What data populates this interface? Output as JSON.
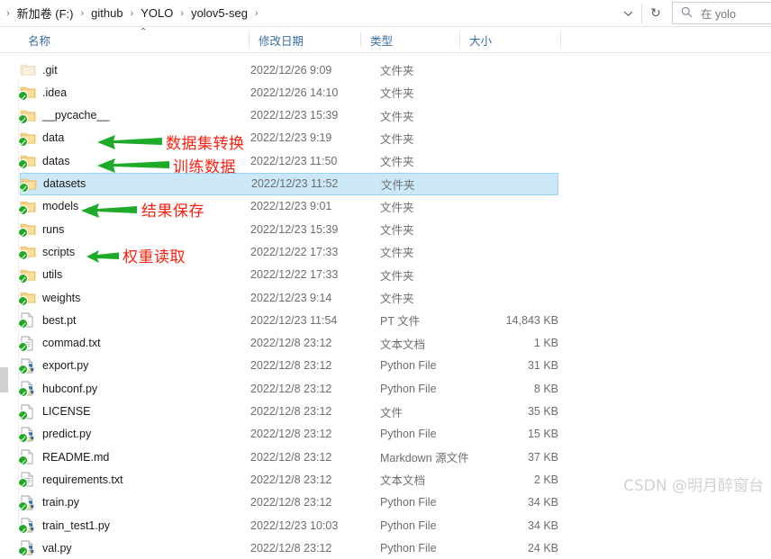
{
  "address": {
    "breadcrumbs": [
      "新加卷 (F:)",
      "github",
      "YOLO",
      "yolov5-seg"
    ],
    "separator": "›",
    "dropdown_icon": "chevron-down-icon",
    "refresh_icon": "refresh-icon",
    "refresh_glyph": "↻",
    "search_icon": "search-icon",
    "search_placeholder": "在 yolo"
  },
  "columns": {
    "name": "名称",
    "date_modified": "修改日期",
    "type": "类型",
    "size": "大小",
    "sort_caret": "⌃"
  },
  "rows": [
    {
      "name": ".git",
      "date": "2022/12/26 9:09",
      "type": "文件夹",
      "size": "",
      "icon": "folder-plain-icon",
      "synced": false
    },
    {
      "name": ".idea",
      "date": "2022/12/26 14:10",
      "type": "文件夹",
      "size": "",
      "icon": "folder-icon",
      "synced": true
    },
    {
      "name": "__pycache__",
      "date": "2022/12/23 15:39",
      "type": "文件夹",
      "size": "",
      "icon": "folder-icon",
      "synced": true
    },
    {
      "name": "data",
      "date": "2022/12/23 9:19",
      "type": "文件夹",
      "size": "",
      "icon": "folder-icon",
      "synced": true
    },
    {
      "name": "datas",
      "date": "2022/12/23 11:50",
      "type": "文件夹",
      "size": "",
      "icon": "folder-icon",
      "synced": true
    },
    {
      "name": "datasets",
      "date": "2022/12/23 11:52",
      "type": "文件夹",
      "size": "",
      "icon": "folder-icon",
      "synced": true
    },
    {
      "name": "models",
      "date": "2022/12/23 9:01",
      "type": "文件夹",
      "size": "",
      "icon": "folder-icon",
      "synced": true
    },
    {
      "name": "runs",
      "date": "2022/12/23 15:39",
      "type": "文件夹",
      "size": "",
      "icon": "folder-icon",
      "synced": true
    },
    {
      "name": "scripts",
      "date": "2022/12/22 17:33",
      "type": "文件夹",
      "size": "",
      "icon": "folder-icon",
      "synced": true
    },
    {
      "name": "utils",
      "date": "2022/12/22 17:33",
      "type": "文件夹",
      "size": "",
      "icon": "folder-icon",
      "synced": true
    },
    {
      "name": "weights",
      "date": "2022/12/23 9:14",
      "type": "文件夹",
      "size": "",
      "icon": "folder-icon",
      "synced": true
    },
    {
      "name": "best.pt",
      "date": "2022/12/23 11:54",
      "type": "PT 文件",
      "size": "14,843 KB",
      "icon": "file-generic-icon",
      "synced": true
    },
    {
      "name": "commad.txt",
      "date": "2022/12/8 23:12",
      "type": "文本文档",
      "size": "1 KB",
      "icon": "file-text-icon",
      "synced": true
    },
    {
      "name": "export.py",
      "date": "2022/12/8 23:12",
      "type": "Python File",
      "size": "31 KB",
      "icon": "file-python-icon",
      "synced": true
    },
    {
      "name": "hubconf.py",
      "date": "2022/12/8 23:12",
      "type": "Python File",
      "size": "8 KB",
      "icon": "file-python-icon",
      "synced": true
    },
    {
      "name": "LICENSE",
      "date": "2022/12/8 23:12",
      "type": "文件",
      "size": "35 KB",
      "icon": "file-generic-icon",
      "synced": true
    },
    {
      "name": "predict.py",
      "date": "2022/12/8 23:12",
      "type": "Python File",
      "size": "15 KB",
      "icon": "file-python-icon",
      "synced": true
    },
    {
      "name": "README.md",
      "date": "2022/12/8 23:12",
      "type": "Markdown 源文件",
      "size": "37 KB",
      "icon": "file-generic-icon",
      "synced": true
    },
    {
      "name": "requirements.txt",
      "date": "2022/12/8 23:12",
      "type": "文本文档",
      "size": "2 KB",
      "icon": "file-text-icon",
      "synced": true
    },
    {
      "name": "train.py",
      "date": "2022/12/8 23:12",
      "type": "Python File",
      "size": "34 KB",
      "icon": "file-python-icon",
      "synced": true
    },
    {
      "name": "train_test1.py",
      "date": "2022/12/23 10:03",
      "type": "Python File",
      "size": "34 KB",
      "icon": "file-python-icon",
      "synced": true
    },
    {
      "name": "val.py",
      "date": "2022/12/8 23:12",
      "type": "Python File",
      "size": "24 KB",
      "icon": "file-python-icon",
      "synced": true
    }
  ],
  "selected_row_index": 5,
  "annotations": [
    {
      "label": "数据集转换",
      "target_row": "datas",
      "arrow": "left-arrow-icon"
    },
    {
      "label": "训练数据",
      "target_row": "datasets",
      "arrow": "left-arrow-icon"
    },
    {
      "label": "结果保存",
      "target_row": "runs",
      "arrow": "left-arrow-icon"
    },
    {
      "label": "权重读取",
      "target_row": "weights",
      "arrow": "left-arrow-icon"
    }
  ],
  "annotation_color": "#fd1f0e",
  "arrow_color": "#1faa2a",
  "selection_color": "#cce8f7",
  "watermark": "CSDN @明月醉窗台"
}
